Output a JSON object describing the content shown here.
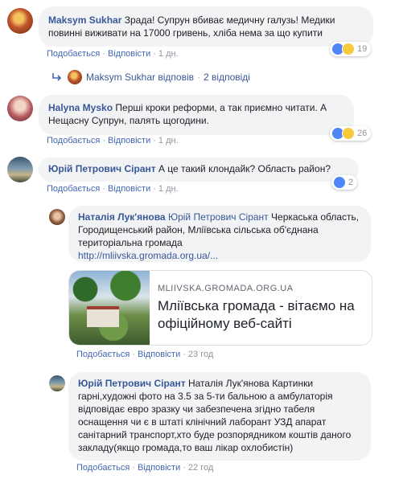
{
  "labels": {
    "like": "Подобається",
    "reply": "Відповісти"
  },
  "comments": [
    {
      "author": "Maksym Sukhar",
      "text": "Зрада! Супрун вбиває медичну галузь! Медики повинні виживати на 17000 гривень, хліба нема за що купити",
      "time": "1 дн.",
      "reactions": "19",
      "avatar_color": "#b04c2a"
    },
    {
      "author": "Halyna Mysko",
      "text": "Перші кроки реформи, а так приємно читати. А Нещасну Супрун, палять щогодини.",
      "time": "1 дн.",
      "reactions": "26",
      "avatar_color": "#a3424c"
    },
    {
      "author": "Юрій Петрович Сірант",
      "text": "А це такий клондайк? Область район?",
      "time": "1 дн.",
      "reactions": "2",
      "avatar_color": "#5c7a8e"
    }
  ],
  "replies_summary": {
    "name": "Maksym Sukhar",
    "verb": "відповів",
    "count": "2 відповіді"
  },
  "reply1": {
    "author": "Наталія Лук'янова",
    "mention": "Юрій Петрович Сірант",
    "text": "Черкаська область, Городищенський район, Мліївська сільська об'єднана територіальна громада",
    "url": "http://mliivska.gromada.org.ua/...",
    "time": "23 год",
    "card": {
      "domain": "MLIIVSKA.GROMADA.ORG.UA",
      "title": "Мліївська громада - вітаємо на офіційному веб-сайті"
    }
  },
  "reply2": {
    "author": "Юрій Петрович Сірант",
    "mention": "Наталія Лук'янова",
    "text": "Картинки гарні,художні фото на 3.5 за 5-ти бальною а амбулаторія відповідає евро зразку чи забезпечена згідно табеля оснащення чи є в штаті клінічний лаборант УЗД апарат санітарний транспорт,хто буде розпорядником коштів даного закладу(якщо громада,то ваш лікар охлобистін)",
    "time": "22 год"
  }
}
